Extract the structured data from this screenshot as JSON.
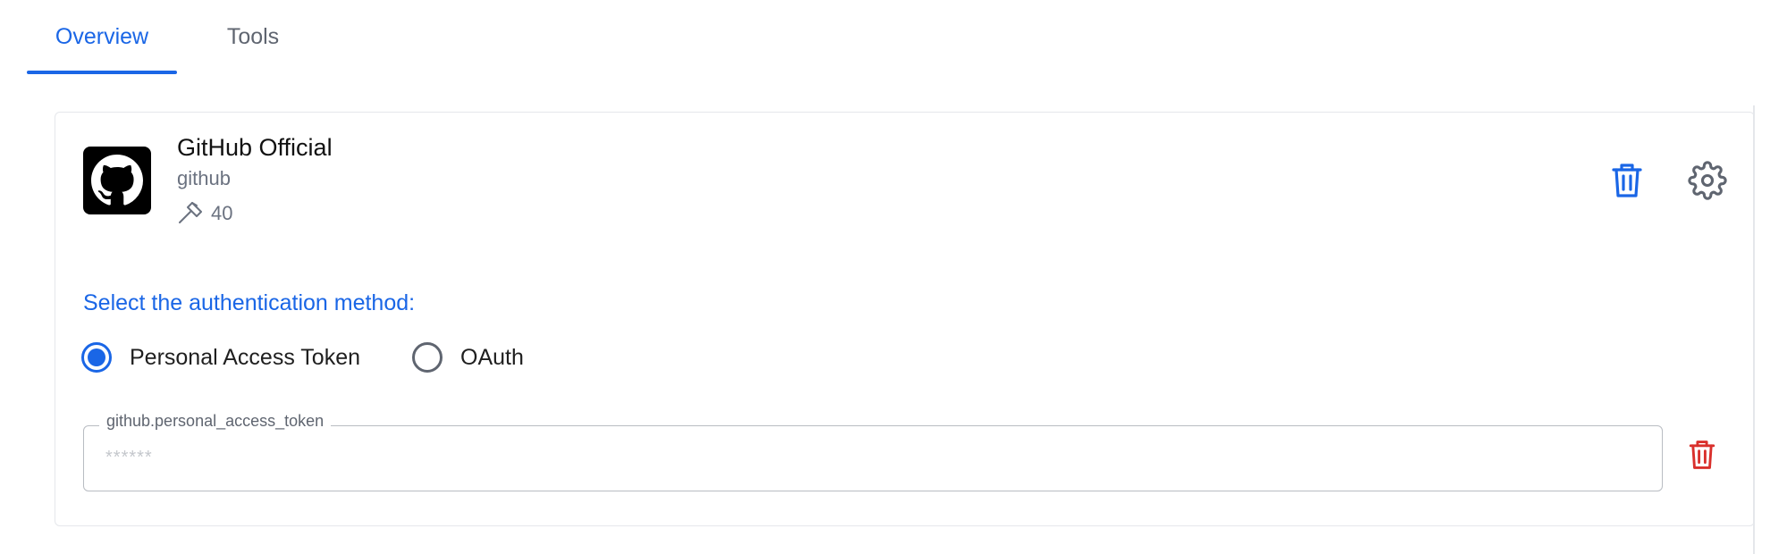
{
  "tabs": {
    "overview": "Overview",
    "tools": "Tools",
    "active": "overview"
  },
  "server": {
    "name": "GitHub Official",
    "id": "github",
    "tools_count": "40",
    "logo_icon": "github-icon",
    "tools_icon": "hammer-icon",
    "delete_icon": "trash-icon",
    "settings_icon": "gear-icon"
  },
  "auth": {
    "heading": "Select the authentication method:",
    "options": [
      {
        "label": "Personal Access Token",
        "selected": true
      },
      {
        "label": "OAuth",
        "selected": false
      }
    ]
  },
  "token_field": {
    "label": "github.personal_access_token",
    "placeholder": "******",
    "value": "",
    "delete_icon": "trash-icon"
  },
  "colors": {
    "accent": "#1a66e6",
    "danger": "#d9302c",
    "muted": "#6b7280",
    "border": "#e5e7eb"
  }
}
